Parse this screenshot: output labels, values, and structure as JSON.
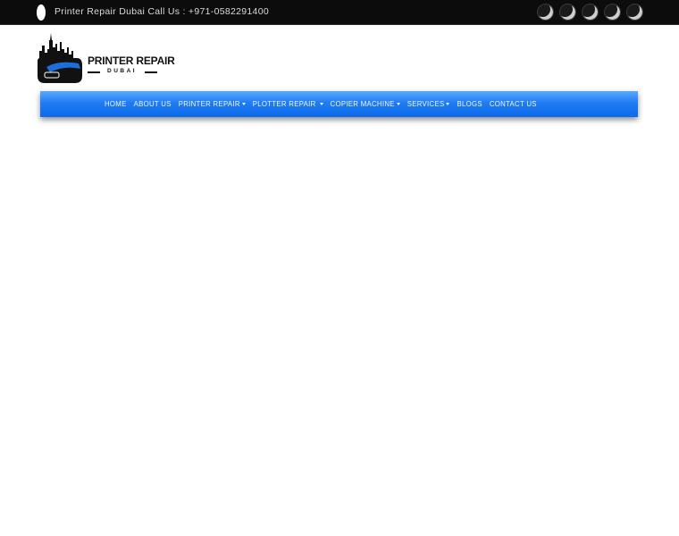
{
  "topbar": {
    "contact_text": "Printer Repair Dubai Call Us : +971-0582291400",
    "phone_icon": "phone-icon",
    "social_icons": [
      "social-icon-1",
      "social-icon-2",
      "social-icon-3",
      "social-icon-4",
      "social-icon-5"
    ]
  },
  "logo": {
    "title": "PRINTER REPAIR",
    "subtitle": "DUBAI"
  },
  "nav": {
    "items": [
      {
        "label": "HOME",
        "dropdown": false
      },
      {
        "label": "ABOUT US",
        "dropdown": false
      },
      {
        "label": "PRINTER REPAIR",
        "dropdown": true
      },
      {
        "label": "PLOTTER REPAIR",
        "dropdown": true
      },
      {
        "label": "COPIER MACHINE",
        "dropdown": true
      },
      {
        "label": "SERVICES",
        "dropdown": true
      },
      {
        "label": "BLOGS",
        "dropdown": false
      },
      {
        "label": "CONTACT US",
        "dropdown": false
      }
    ]
  },
  "colors": {
    "topbar_bg": "#0c0c0c",
    "nav_blue": "#1f7cf3"
  }
}
